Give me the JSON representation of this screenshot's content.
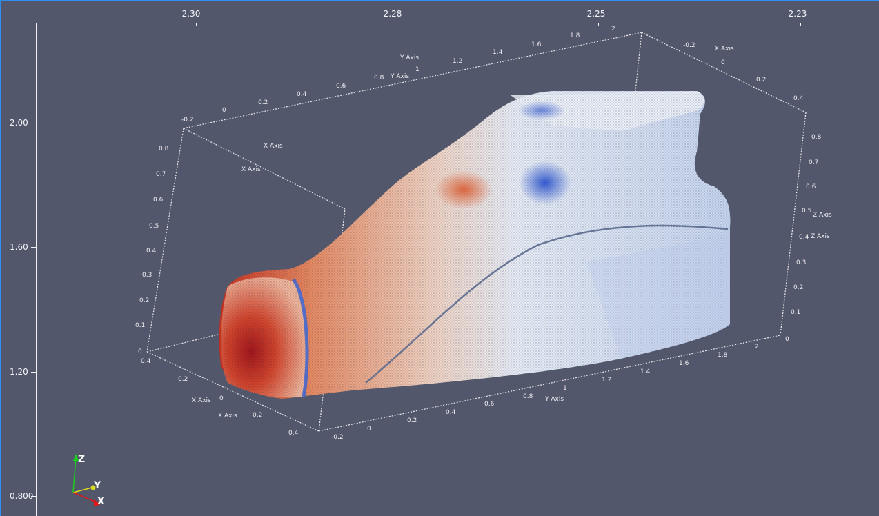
{
  "viewport": {
    "background": "#52576b",
    "focus_border_color": "#2f8ef4"
  },
  "top_ruler": {
    "labels": [
      "2.30",
      "2.28",
      "2.25",
      "2.23"
    ]
  },
  "left_ruler": {
    "labels": [
      "2.00",
      "1.60",
      "1.20",
      "0.800"
    ]
  },
  "cube_axes": {
    "axis_titles": [
      "X Axis",
      "X Axis",
      "Y Axis",
      "Y Axis",
      "Z Axis",
      "Z Axis",
      "X Axis",
      "X Axis",
      "X Axis",
      "Y Axis"
    ],
    "top_back_ticks": [
      "-0.2",
      "0",
      "0.2",
      "0.4",
      "0.6",
      "0.8",
      "1",
      "1.2",
      "1.4",
      "1.6",
      "1.8",
      "2"
    ],
    "right_top_ticks": [
      "-0.2",
      "0",
      "0.2",
      "0.4"
    ],
    "right_vertical_ticks": [
      "0.8",
      "0.7",
      "0.6",
      "0.5",
      "0.4",
      "0.3",
      "0.2",
      "0.1",
      "0"
    ],
    "left_vertical_ticks": [
      "0.8",
      "0.7",
      "0.6",
      "0.5",
      "0.4",
      "0.3",
      "0.2",
      "0.1",
      "0"
    ],
    "bottom_front_ticks": [
      "-0.2",
      "0",
      "0.2",
      "0.4",
      "0.6",
      "0.8",
      "1",
      "1.2",
      "1.4",
      "1.6",
      "1.8",
      "2"
    ],
    "left_bottom_ticks": [
      "0.4",
      "0.2",
      "0",
      "0.2",
      "0.4"
    ]
  },
  "orientation_widget": {
    "z_label": "Z",
    "y_label": "Y",
    "x_label": "X",
    "z_color": "#19d119",
    "y_color": "#d8d820",
    "x_color": "#e01515"
  },
  "colormap": {
    "low": "#3a5fd6",
    "mid": "#e9eef7",
    "high": "#b4161e"
  }
}
